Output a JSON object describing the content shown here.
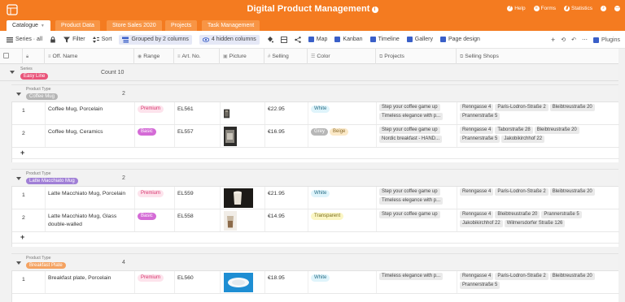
{
  "app": {
    "title": "Digital Product Management",
    "top_links": [
      {
        "label": "Help",
        "icon": "help-icon"
      },
      {
        "label": "Forms",
        "icon": "forms-icon"
      },
      {
        "label": "Statistics",
        "icon": "statistics-icon"
      },
      {
        "label": "",
        "icon": "bell-icon"
      },
      {
        "label": "",
        "icon": "more-icon"
      }
    ]
  },
  "tabs": [
    "Catalogue",
    "Product Data",
    "Store Sales 2020",
    "Projects",
    "Task Management"
  ],
  "toolbar": {
    "view": "Series · all",
    "filter": "Filter",
    "sort": "Sort",
    "grouped": "Grouped by 2 columns",
    "hidden": "4 hidden columns",
    "map": "Map",
    "kanban": "Kanban",
    "timeline": "Timeline",
    "gallery": "Gallery",
    "page_design": "Page design",
    "plugins": "Plugins"
  },
  "columns": [
    "Off. Name",
    "Range",
    "Art. No.",
    "Picture",
    "Selling",
    "Color",
    "Projects",
    "Selling Shops"
  ],
  "colors": {
    "brand": "#f47b20",
    "premium_bg": "#fde3ec",
    "premium_fg": "#d6336c",
    "basic_bg": "#d46bd6",
    "white_bg": "#dff4fb",
    "grey_bg": "#b7b7b7",
    "beige_bg": "#fbe9c8",
    "transparent_bg": "#fbf6c4"
  },
  "groups": {
    "series": {
      "label": "Series",
      "value": "Easy Line",
      "count_label": "Count",
      "count": "10"
    },
    "types": [
      {
        "label": "Product Type",
        "value": "Coffee Mug",
        "count": "2",
        "rows": [
          {
            "num": "1",
            "name": "Coffee Mug, Porcelain",
            "range": "Premium",
            "art": "EL561",
            "selling": "€22.95",
            "colors": [
              "White"
            ],
            "projects": [
              "Step your coffee game up",
              "Timeless elegance with p..."
            ],
            "shops": [
              "Renngasse 4",
              "Paris-Lodron-Straße 2",
              "Bleibtreustraße 20",
              "Prannerstraße 5"
            ]
          },
          {
            "num": "2",
            "name": "Coffee Mug, Ceramics",
            "range": "Basic",
            "art": "EL557",
            "selling": "€16.95",
            "colors": [
              "Grey",
              "Beige"
            ],
            "projects": [
              "Step your coffee game up",
              "Nordic breakfast - HAND..."
            ],
            "shops": [
              "Renngasse 4",
              "Taborstraße 28",
              "Bleibtreustraße 20",
              "Prannerstraße 5",
              "Jakobikirchhof 22"
            ]
          }
        ]
      },
      {
        "label": "Product Type",
        "value": "Latte Macchiato Mug",
        "count": "2",
        "rows": [
          {
            "num": "1",
            "name": "Latte Macchiato Mug, Porcelain",
            "range": "Premium",
            "art": "EL559",
            "selling": "€21.95",
            "colors": [
              "White"
            ],
            "projects": [
              "Step your coffee game up",
              "Timeless elegance with p..."
            ],
            "shops": [
              "Renngasse 4",
              "Paris-Lodron-Straße 2",
              "Bleibtreustraße 20"
            ]
          },
          {
            "num": "2",
            "name": "Latte Macchiato Mug, Glass double-walled",
            "range": "Basic",
            "art": "EL558",
            "selling": "€14.95",
            "colors": [
              "Transparent"
            ],
            "projects": [
              "Step your coffee game up"
            ],
            "shops": [
              "Renngasse 4",
              "Bleibtreustraße 20",
              "Prannerstraße 5",
              "Jakobikirchhof 22",
              "Wilmersdorfer Straße 126"
            ]
          }
        ]
      },
      {
        "label": "Product Type",
        "value": "Breakfast Plate",
        "count": "4",
        "rows": [
          {
            "num": "1",
            "name": "Breakfast plate, Porcelain",
            "range": "Premium",
            "art": "EL560",
            "selling": "€18.95",
            "colors": [
              "White"
            ],
            "projects": [
              "Timeless elegance with p..."
            ],
            "shops": [
              "Renngasse 4",
              "Paris-Lodron-Straße 2",
              "Bleibtreustraße 20",
              "Prannerstraße 5"
            ]
          }
        ]
      }
    ]
  }
}
